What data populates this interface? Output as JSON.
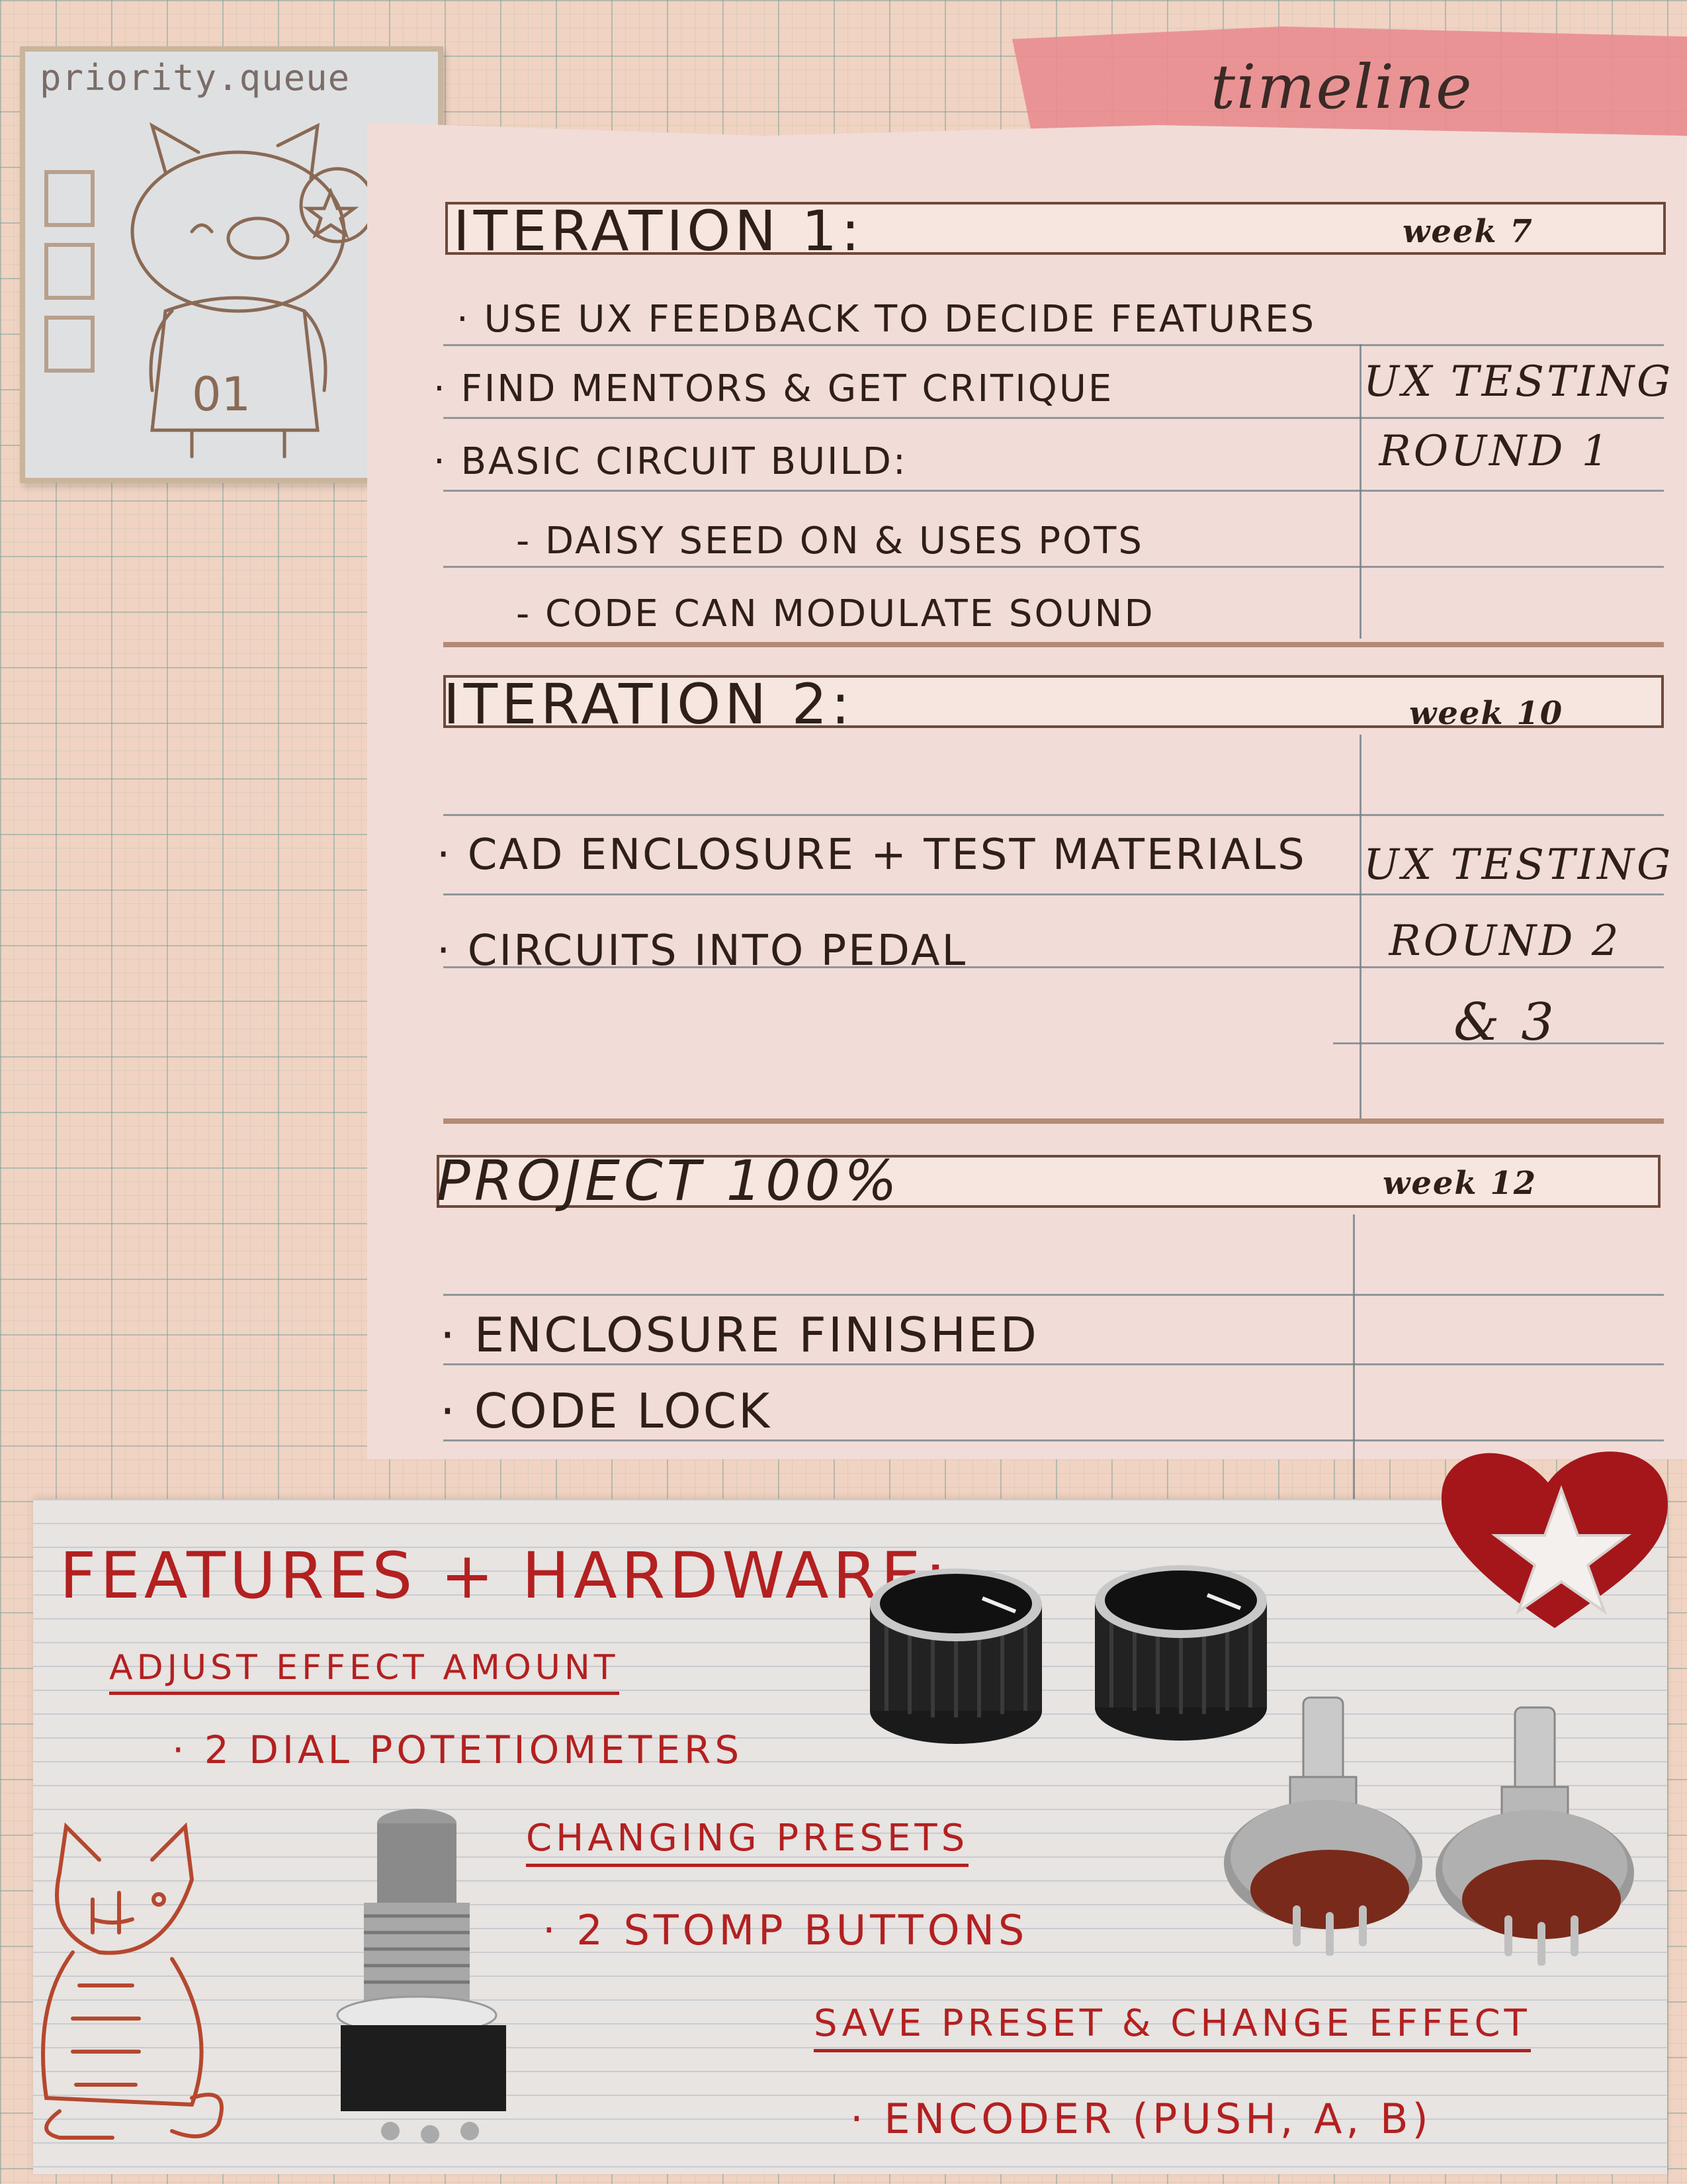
{
  "colors": {
    "grid_background": "#f0d3c2",
    "paper": "#f2dcd8",
    "ink": "#2e1f18",
    "red_ink": "#b32020",
    "tape": "#e98c8f",
    "heart": "#a4161a"
  },
  "stamp": {
    "title": "priority.queue",
    "badge": "01"
  },
  "header": {
    "title": "timeline"
  },
  "iterations": [
    {
      "title": "ITERATION 1:",
      "week": "week 7",
      "tasks": [
        "· USE UX FEEDBACK TO DECIDE FEATURES",
        "· FIND MENTORS & GET CRITIQUE",
        "· BASIC CIRCUIT BUILD:",
        "- DAISY SEED ON & USES POTS",
        "- CODE CAN MODULATE SOUND"
      ],
      "side_note": [
        "UX TESTING",
        "ROUND 1"
      ]
    },
    {
      "title": "ITERATION 2:",
      "week": "week 10",
      "tasks": [
        "· CAD ENCLOSURE + TEST MATERIALS",
        "· CIRCUITS INTO PEDAL"
      ],
      "side_note": [
        "UX TESTING",
        "ROUND 2",
        "& 3"
      ]
    },
    {
      "title": "PROJECT 100%",
      "week": "week 12",
      "tasks": [
        "· ENCLOSURE FINISHED",
        "· CODE LOCK"
      ]
    }
  ],
  "features": {
    "title": "FEATURES + HARDWARE:",
    "groups": [
      {
        "heading": "ADJUST EFFECT AMOUNT",
        "item": "· 2 DIAL POTETIOMETERS"
      },
      {
        "heading": "CHANGING PRESETS",
        "item": "· 2 STOMP BUTTONS"
      },
      {
        "heading": "SAVE PRESET & CHANGE EFFECT",
        "item": "· ENCODER (PUSH, A, B)"
      }
    ]
  },
  "icons": [
    "knob-icon",
    "potentiometer-icon",
    "stomp-switch-icon",
    "heart-star-icon",
    "cat-illustration",
    "character-stamp"
  ]
}
